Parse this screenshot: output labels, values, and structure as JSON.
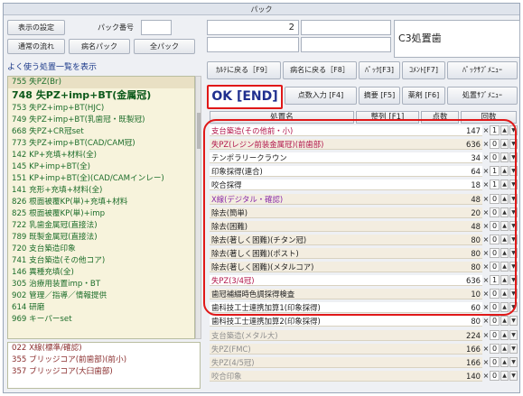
{
  "window": {
    "title": "パック"
  },
  "top_left": {
    "display_settings": "表示の設定",
    "pack_number_label": "パック番号",
    "pack_number_value": "",
    "normal_flow": "通常の流れ",
    "disease_pack": "病名パック",
    "all_pack": "全パック"
  },
  "list_header": "よく使う処置一覧を表示",
  "list_items": [
    {
      "code": "755",
      "label": "失PZ(Br)"
    },
    {
      "code": "748",
      "label": "失PZ+imp+BT(金属冠)"
    },
    {
      "code": "753",
      "label": "失PZ+imp+BT(HJC)"
    },
    {
      "code": "749",
      "label": "失PZ+imp+BT(乳歯冠・既製冠)"
    },
    {
      "code": "668",
      "label": "失PZ+CR冠set"
    },
    {
      "code": "773",
      "label": "失PZ+imp+BT(CAD/CAM冠)"
    },
    {
      "code": "142",
      "label": "KP+充填+材料(全)"
    },
    {
      "code": "145",
      "label": "KP+imp+BT(全)"
    },
    {
      "code": "151",
      "label": "KP+imp+BT(全)(CAD/CAMインレー)"
    },
    {
      "code": "141",
      "label": "充形+充填+材料(全)"
    },
    {
      "code": "826",
      "label": "根面被覆KP(単)+充填+材料"
    },
    {
      "code": "825",
      "label": "根面被覆KP(単)+imp"
    },
    {
      "code": "722",
      "label": "乳歯金属冠(直接法)"
    },
    {
      "code": "789",
      "label": "既製金属冠(直接法)"
    },
    {
      "code": "720",
      "label": "支台築造印象"
    },
    {
      "code": "741",
      "code_note": "",
      "label": "支台築造(その他コア)"
    },
    {
      "code": "146",
      "label": "異種充填(全)"
    },
    {
      "code": "305",
      "label": "治療用装置imp・BT"
    },
    {
      "code": "902",
      "label": "管理／指導／情報提供"
    },
    {
      "code": "614",
      "label": "研磨"
    },
    {
      "code": "969",
      "label": "キーパーset"
    }
  ],
  "list2_items": [
    {
      "code": "022",
      "label": "X線(標準/確認)"
    },
    {
      "code": "355",
      "label": "ブリッジコア(前歯部)(前小)"
    },
    {
      "code": "357",
      "label": "ブリッジコア(大臼歯部)"
    }
  ],
  "top_right": {
    "number_value": "2",
    "field_value": "",
    "title": "C3処置歯"
  },
  "buttons": {
    "back_f9": "ｶﾙﾃに戻る［F9］",
    "disease_back_f8": "病名に戻る［F8］",
    "pack_f3": "ﾊﾟｯｸ[F3]",
    "comment_f7": "ｺﾒﾝﾄ[F7]",
    "pack_sub_menu": "ﾊﾟｯｸｻﾌﾞﾒﾆｭｰ",
    "ok_end": "OK [END]",
    "points_input_f4": "点数入力 [F4]",
    "summary_f5": "摘要 [F5]",
    "drug_f6": "薬剤 [F6]",
    "treatment_sub_menu": "処置ｻﾌﾞﾒﾆｭｰ"
  },
  "table": {
    "headers": {
      "name": "処置名",
      "sort": "整列 [F1]",
      "points": "点数",
      "count": "回数"
    },
    "rows": [
      {
        "name": "支台築造(その他前・小)",
        "points": "147",
        "count": "1",
        "color": "red",
        "bg": "white"
      },
      {
        "name": "失PZ(レジン前装金属冠)(前歯部)",
        "points": "636",
        "count": "0",
        "color": "red",
        "bg": "beige"
      },
      {
        "name": "テンポラリークラウン",
        "points": "34",
        "count": "0",
        "color": "dark",
        "bg": "white"
      },
      {
        "name": "印象採得(連合)",
        "points": "64",
        "count": "1",
        "color": "dark",
        "bg": "white"
      },
      {
        "name": "咬合採得",
        "points": "18",
        "count": "1",
        "color": "dark",
        "bg": "white"
      },
      {
        "name": "X線(デジタル・確認)",
        "points": "48",
        "count": "0",
        "color": "purple",
        "bg": "beige"
      },
      {
        "name": "除去(簡単)",
        "points": "20",
        "count": "0",
        "color": "dark",
        "bg": "beige"
      },
      {
        "name": "除去(困難)",
        "points": "48",
        "count": "0",
        "color": "dark",
        "bg": "beige"
      },
      {
        "name": "除去(著しく困難)(チタン冠)",
        "points": "80",
        "count": "0",
        "color": "dark",
        "bg": "beige"
      },
      {
        "name": "除去(著しく困難)(ポスト)",
        "points": "80",
        "count": "0",
        "color": "dark",
        "bg": "beige"
      },
      {
        "name": "除去(著しく困難)(メタルコア)",
        "points": "80",
        "count": "0",
        "color": "dark",
        "bg": "beige"
      },
      {
        "name": "失PZ(3/4冠)",
        "points": "636",
        "count": "1",
        "color": "red",
        "bg": "white"
      },
      {
        "name": "歯冠補綴時色調採得検査",
        "points": "10",
        "count": "0",
        "color": "dark",
        "bg": "beige"
      },
      {
        "name": "歯科技工士連携加算1(印象採得)",
        "points": "60",
        "count": "0",
        "color": "dark",
        "bg": "white"
      },
      {
        "name": "歯科技工士連携加算2(印象採得)",
        "points": "80",
        "count": "0",
        "color": "dark",
        "bg": "white"
      },
      {
        "name": "支台築造(メタル大)",
        "points": "224",
        "count": "0",
        "color": "gray",
        "bg": "beige"
      },
      {
        "name": "失PZ(FMC)",
        "points": "166",
        "count": "0",
        "color": "gray",
        "bg": "beige"
      },
      {
        "name": "失PZ(4/5冠)",
        "points": "166",
        "count": "0",
        "color": "gray",
        "bg": "beige"
      },
      {
        "name": "咬合印象",
        "points": "140",
        "count": "0",
        "color": "gray",
        "bg": "beige"
      }
    ],
    "multiply_sign": "×",
    "up_arrow": "▲",
    "down_arrow": "▼"
  }
}
